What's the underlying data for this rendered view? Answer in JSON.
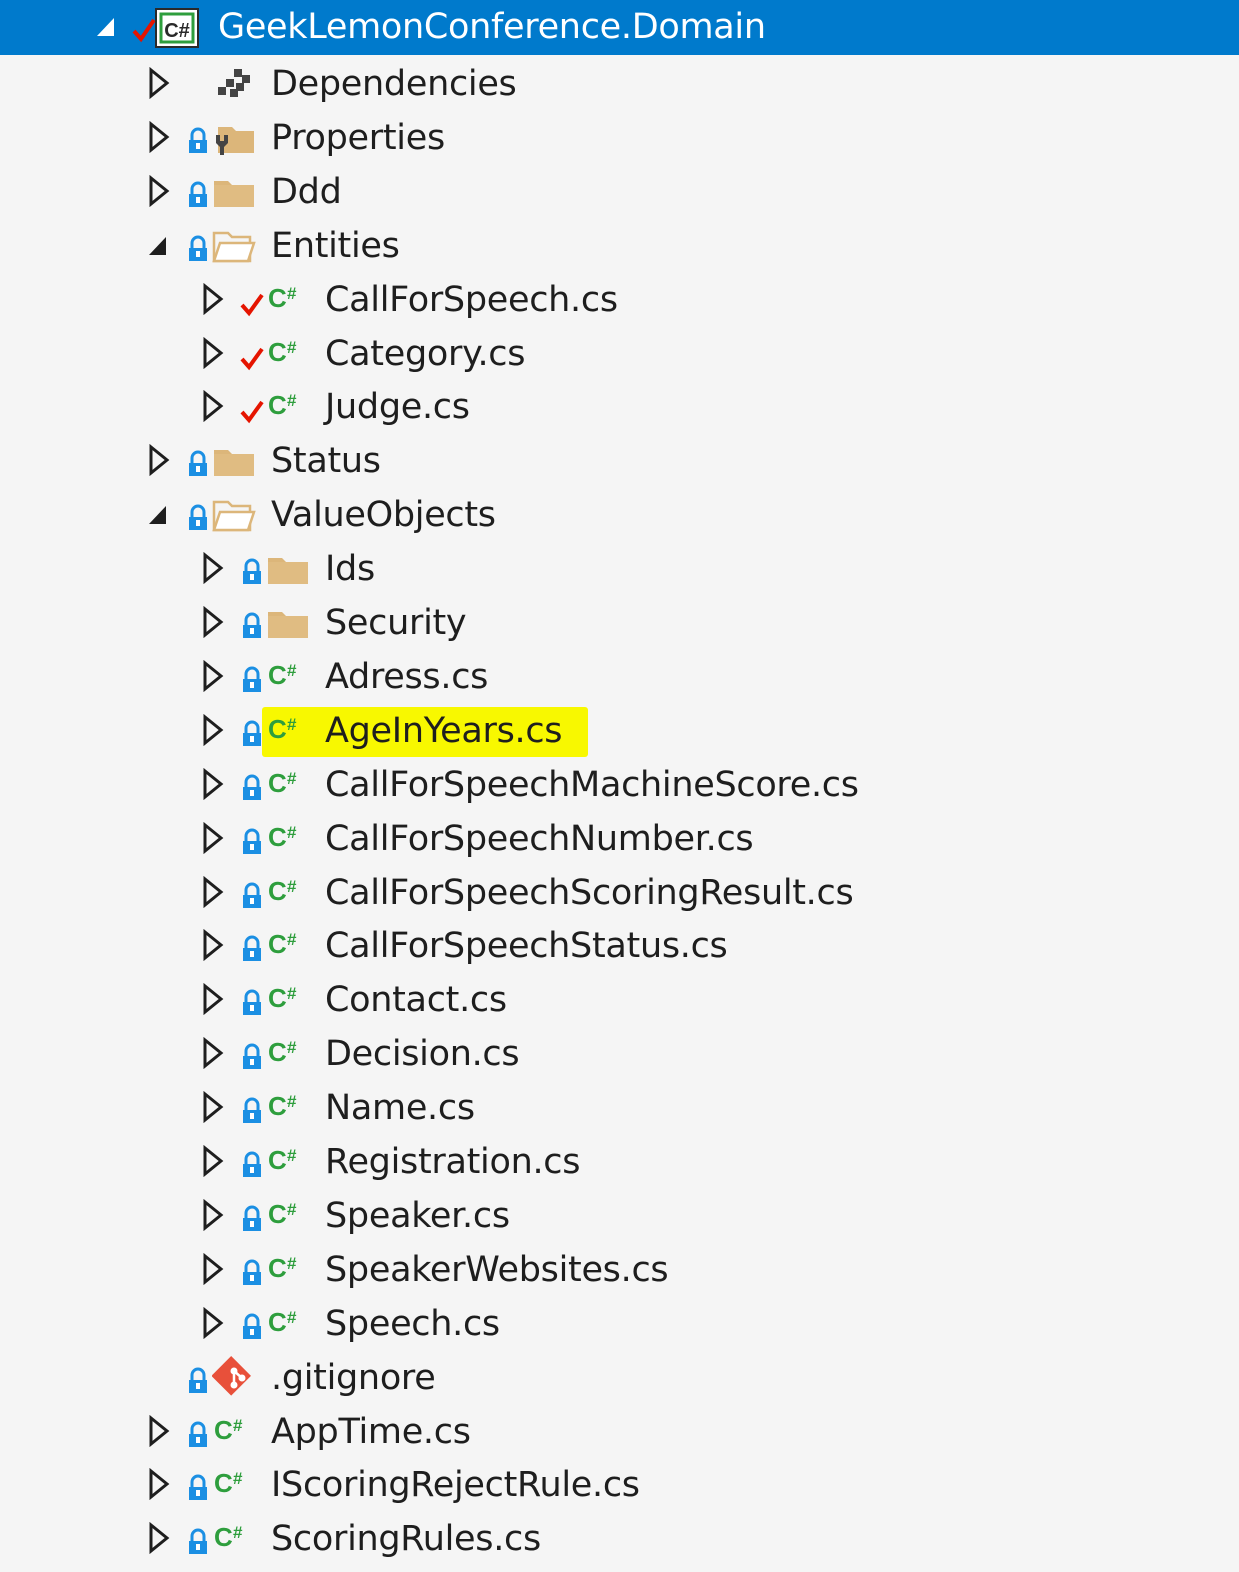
{
  "explorer": {
    "project": {
      "name": "GeekLemonConference.Domain",
      "icon": "csharp-project-icon",
      "status": "checked-out-check",
      "expanded": true,
      "selected": true
    },
    "items": [
      {
        "label": "Dependencies",
        "level": 1,
        "expand": "collapsed",
        "icon": "dependencies-icon",
        "status": "none"
      },
      {
        "label": "Properties",
        "level": 1,
        "expand": "collapsed",
        "icon": "properties-folder-icon",
        "status": "lock"
      },
      {
        "label": "Ddd",
        "level": 1,
        "expand": "collapsed",
        "icon": "folder-icon",
        "status": "lock"
      },
      {
        "label": "Entities",
        "level": 1,
        "expand": "expanded",
        "icon": "folder-open-icon",
        "status": "lock"
      },
      {
        "label": "CallForSpeech.cs",
        "level": 2,
        "expand": "collapsed",
        "icon": "csharp-file-icon",
        "status": "check"
      },
      {
        "label": "Category.cs",
        "level": 2,
        "expand": "collapsed",
        "icon": "csharp-file-icon",
        "status": "check"
      },
      {
        "label": "Judge.cs",
        "level": 2,
        "expand": "collapsed",
        "icon": "csharp-file-icon",
        "status": "check"
      },
      {
        "label": "Status",
        "level": 1,
        "expand": "collapsed",
        "icon": "folder-icon",
        "status": "lock"
      },
      {
        "label": "ValueObjects",
        "level": 1,
        "expand": "expanded",
        "icon": "folder-open-icon",
        "status": "lock"
      },
      {
        "label": "Ids",
        "level": 2,
        "expand": "collapsed",
        "icon": "folder-icon",
        "status": "lock"
      },
      {
        "label": "Security",
        "level": 2,
        "expand": "collapsed",
        "icon": "folder-icon",
        "status": "lock"
      },
      {
        "label": "Adress.cs",
        "level": 2,
        "expand": "collapsed",
        "icon": "csharp-file-icon",
        "status": "lock"
      },
      {
        "label": "AgeInYears.cs",
        "level": 2,
        "expand": "collapsed",
        "icon": "csharp-file-icon",
        "status": "lock",
        "highlighted": true
      },
      {
        "label": "CallForSpeechMachineScore.cs",
        "level": 2,
        "expand": "collapsed",
        "icon": "csharp-file-icon",
        "status": "lock"
      },
      {
        "label": "CallForSpeechNumber.cs",
        "level": 2,
        "expand": "collapsed",
        "icon": "csharp-file-icon",
        "status": "lock"
      },
      {
        "label": "CallForSpeechScoringResult.cs",
        "level": 2,
        "expand": "collapsed",
        "icon": "csharp-file-icon",
        "status": "lock"
      },
      {
        "label": "CallForSpeechStatus.cs",
        "level": 2,
        "expand": "collapsed",
        "icon": "csharp-file-icon",
        "status": "lock"
      },
      {
        "label": "Contact.cs",
        "level": 2,
        "expand": "collapsed",
        "icon": "csharp-file-icon",
        "status": "lock"
      },
      {
        "label": "Decision.cs",
        "level": 2,
        "expand": "collapsed",
        "icon": "csharp-file-icon",
        "status": "lock"
      },
      {
        "label": "Name.cs",
        "level": 2,
        "expand": "collapsed",
        "icon": "csharp-file-icon",
        "status": "lock"
      },
      {
        "label": "Registration.cs",
        "level": 2,
        "expand": "collapsed",
        "icon": "csharp-file-icon",
        "status": "lock"
      },
      {
        "label": "Speaker.cs",
        "level": 2,
        "expand": "collapsed",
        "icon": "csharp-file-icon",
        "status": "lock"
      },
      {
        "label": "SpeakerWebsites.cs",
        "level": 2,
        "expand": "collapsed",
        "icon": "csharp-file-icon",
        "status": "lock"
      },
      {
        "label": "Speech.cs",
        "level": 2,
        "expand": "collapsed",
        "icon": "csharp-file-icon",
        "status": "lock"
      },
      {
        "label": ".gitignore",
        "level": 1,
        "expand": "none",
        "icon": "git-icon",
        "status": "lock"
      },
      {
        "label": "AppTime.cs",
        "level": 1,
        "expand": "collapsed",
        "icon": "csharp-file-icon",
        "status": "lock"
      },
      {
        "label": "IScoringRejectRule.cs",
        "level": 1,
        "expand": "collapsed",
        "icon": "csharp-file-icon",
        "status": "lock"
      },
      {
        "label": "ScoringRules.cs",
        "level": 1,
        "expand": "collapsed",
        "icon": "csharp-file-icon",
        "status": "lock"
      }
    ],
    "colors": {
      "selection": "#007acc",
      "background": "#f5f5f5",
      "highlight": "#f8f800",
      "csharp": "#2e9e3d",
      "lock": "#1b8fe3",
      "check": "#e51400",
      "folder": "#dcb67a",
      "git": "#e8503a"
    }
  }
}
